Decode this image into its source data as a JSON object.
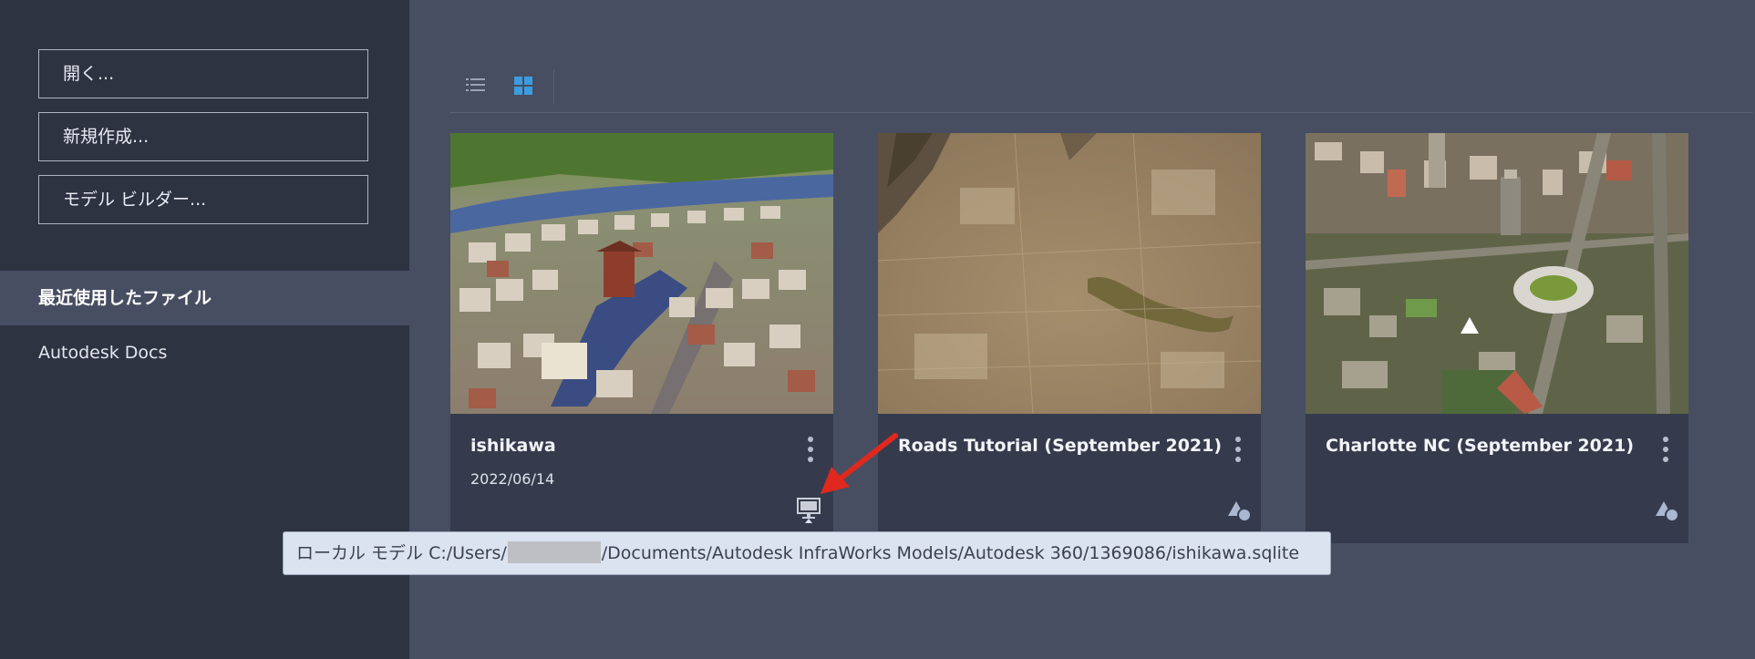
{
  "sidebar": {
    "buttons": [
      {
        "label": "開く..."
      },
      {
        "label": "新規作成..."
      },
      {
        "label": "モデル ビルダー..."
      }
    ],
    "nav": [
      {
        "label": "最近使用したファイル",
        "selected": true
      },
      {
        "label": "Autodesk Docs",
        "selected": false
      }
    ]
  },
  "toolbar": {
    "list_view_icon": "list-icon",
    "grid_view_icon": "grid-icon",
    "active_view": "grid"
  },
  "cards": [
    {
      "title": "ishikawa",
      "date": "2022/06/14",
      "storage_icon": "monitor-icon"
    },
    {
      "title": "Roads Tutorial (September 2021)",
      "date": "",
      "storage_icon": "shapes-icon"
    },
    {
      "title": "Charlotte NC (September 2021)",
      "date": "",
      "storage_icon": "shapes-icon"
    }
  ],
  "tooltip": {
    "prefix": "ローカル モデル C:/Users/",
    "suffix": "/Documents/Autodesk InfraWorks Models/Autodesk 360/1369086/ishikawa.sqlite"
  },
  "colors": {
    "background": "#474e61",
    "sidebar": "#2e3342",
    "card": "#353b4c",
    "accent_blue": "#3d9be0",
    "arrow_red": "#e0281e",
    "tooltip_bg": "#dbe3f0"
  }
}
